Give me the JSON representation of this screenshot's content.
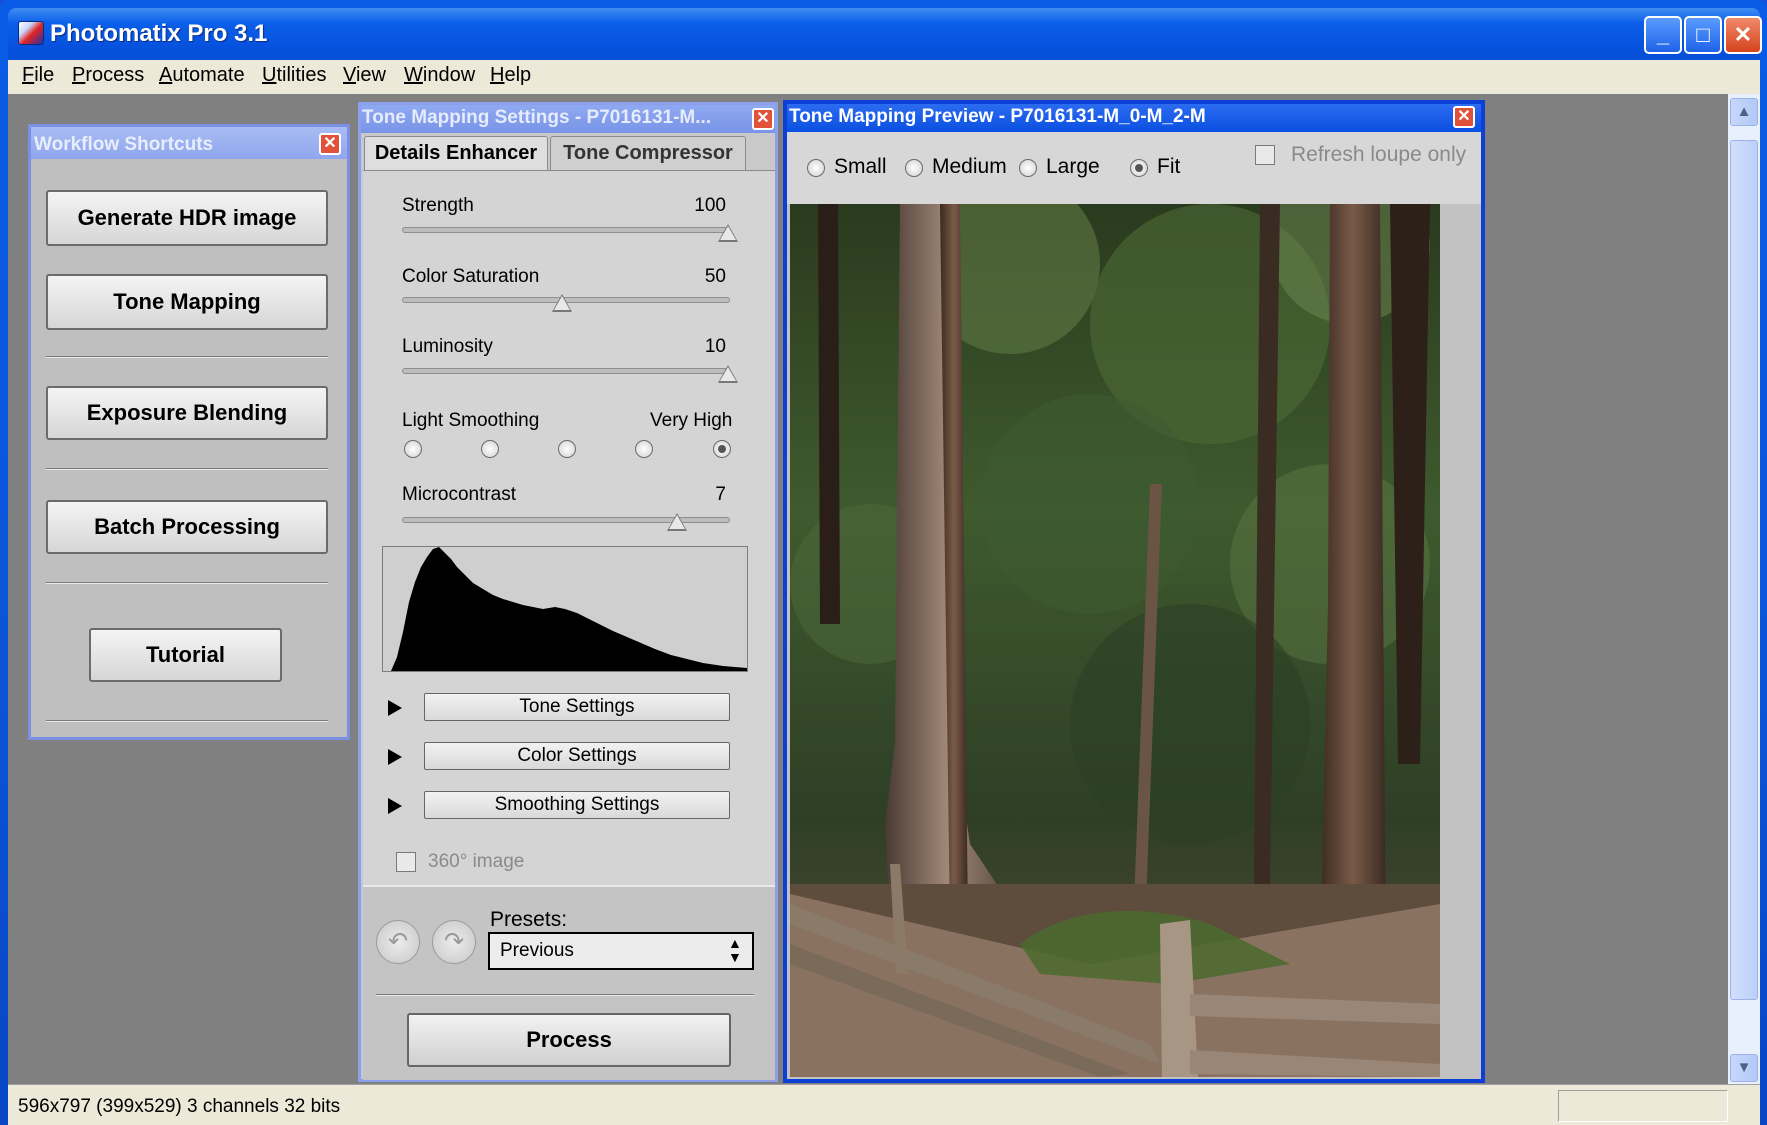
{
  "app": {
    "title": "Photomatix Pro 3.1"
  },
  "window_controls": {
    "minimize": "_",
    "maximize": "□",
    "close": "✕"
  },
  "menu": [
    {
      "label": "File",
      "key": "F",
      "rest": "ile"
    },
    {
      "label": "Process",
      "key": "P",
      "rest": "rocess"
    },
    {
      "label": "Automate",
      "key": "A",
      "rest": "utomate"
    },
    {
      "label": "Utilities",
      "key": "U",
      "rest": "tilities"
    },
    {
      "label": "View",
      "key": "V",
      "rest": "iew"
    },
    {
      "label": "Window",
      "key": "W",
      "rest": "indow"
    },
    {
      "label": "Help",
      "key": "H",
      "rest": "elp"
    }
  ],
  "workflow": {
    "title": "Workflow Shortcuts",
    "buttons": {
      "generate_hdr": "Generate HDR image",
      "tone_mapping": "Tone Mapping",
      "exposure_blending": "Exposure Blending",
      "batch_processing": "Batch Processing",
      "tutorial": "Tutorial"
    }
  },
  "tone_settings": {
    "title": "Tone Mapping Settings - P7016131-M...",
    "tabs": {
      "details": "Details Enhancer",
      "compressor": "Tone Compressor"
    },
    "sliders": {
      "strength": {
        "label": "Strength",
        "value": "100"
      },
      "color_saturation": {
        "label": "Color Saturation",
        "value": "50"
      },
      "luminosity": {
        "label": "Luminosity",
        "value": "10"
      },
      "microcontrast": {
        "label": "Microcontrast",
        "value": "7"
      }
    },
    "light_smoothing": {
      "label": "Light Smoothing",
      "value_label": "Very High",
      "selected_index": 4
    },
    "expanders": {
      "tone": "Tone Settings",
      "color": "Color Settings",
      "smoothing": "Smoothing Settings"
    },
    "checkbox_360": "360° image",
    "presets": {
      "label": "Presets:",
      "selected": "Previous"
    },
    "undo_icon": "↶",
    "redo_icon": "↷",
    "process_label": "Process"
  },
  "preview": {
    "title": "Tone Mapping Preview - P7016131-M_0-M_2-M",
    "sizes": {
      "small": "Small",
      "medium": "Medium",
      "large": "Large",
      "fit": "Fit"
    },
    "selected_size": "Fit",
    "refresh_loupe": "Refresh loupe only"
  },
  "status": {
    "text": "596x797 (399x529) 3 channels 32 bits"
  },
  "colors": {
    "xp_blue": "#0b54d8",
    "panel_gray": "#c9c9c9",
    "close_red": "#d6431d"
  }
}
